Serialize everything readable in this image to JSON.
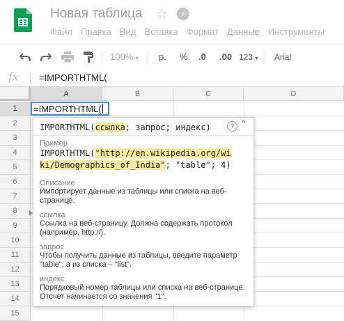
{
  "app": {
    "title": "Новая таблица",
    "menu": [
      "Файл",
      "Правка",
      "Вид",
      "Вставка",
      "Формат",
      "Данные",
      "Инструменты"
    ]
  },
  "toolbar": {
    "zoom": "100%",
    "currency": "р.",
    "percent": "%",
    "dec_decrease": ".0",
    "dec_increase": ".00",
    "more_formats": "123",
    "font": "Arial"
  },
  "formula_bar": {
    "fx": "fx",
    "content": "=IMPORTHTML("
  },
  "grid": {
    "columns": [
      "A",
      "B",
      "C",
      "D"
    ],
    "rows": [
      "1",
      "2",
      "3",
      "4",
      "5",
      "6",
      "7",
      "8",
      "9",
      "10",
      "11",
      "12",
      "13",
      "14",
      "15"
    ],
    "active_cell_text": "=IMPORTHTML("
  },
  "help": {
    "func": "IMPORTHTML(",
    "arg1": "ссылка",
    "rest": "; запрос; индекс)",
    "example_label": "Пример",
    "example_line1_pre": "IMPORTHTML(",
    "example_line1_hl": "\"http://en.wikipedia.org/wi",
    "example_line2_hl": "ki/Demographics_of_India\"",
    "example_line2_rest": "; \"table\"; 4)",
    "desc_label": "Описание",
    "desc_text": "Импортирует данные из таблицы или списка на веб-странице.",
    "p1_label": "ссылка",
    "p1_text": "Ссылка на веб-страницу. Должна содержать протокол (например, http://).",
    "p2_label": "запрос",
    "p2_text": "Чтобы получить данные из таблицы, введите параметр \"table\", а из списка – \"list\".",
    "p3_label": "индекс",
    "p3_text": "Порядковый номер таблицы или списка на веб-странице. Отсчет начинается со значения \"1\"."
  },
  "colors": {
    "accent": "#4285f4",
    "logo": "#0f9d58",
    "highlight": "#fdeaa6"
  }
}
